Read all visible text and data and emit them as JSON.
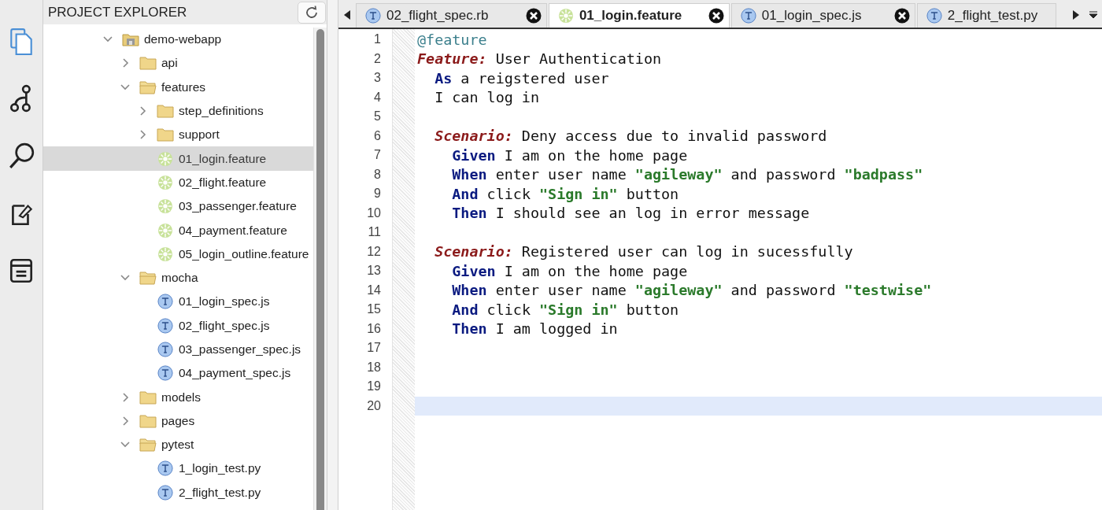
{
  "activity_bar": [
    {
      "kind": "files",
      "selected": true
    },
    {
      "kind": "branch",
      "selected": false
    },
    {
      "kind": "search",
      "selected": false
    },
    {
      "kind": "note",
      "selected": false
    },
    {
      "kind": "list",
      "selected": false
    }
  ],
  "explorer": {
    "title": "PROJECT EXPLORER",
    "tree": [
      {
        "label": "demo-webapp",
        "kind": "project",
        "expanded": true,
        "selected": false,
        "children": [
          {
            "label": "api",
            "kind": "folder",
            "expanded": false,
            "selected": false
          },
          {
            "label": "features",
            "kind": "folder",
            "expanded": true,
            "selected": false,
            "children": [
              {
                "label": "step_definitions",
                "kind": "folder",
                "expanded": false,
                "selected": false
              },
              {
                "label": "support",
                "kind": "folder",
                "expanded": false,
                "selected": false
              },
              {
                "label": "01_login.feature",
                "kind": "feature",
                "selected": true
              },
              {
                "label": "02_flight.feature",
                "kind": "feature",
                "selected": false
              },
              {
                "label": "03_passenger.feature",
                "kind": "feature",
                "selected": false
              },
              {
                "label": "04_payment.feature",
                "kind": "feature",
                "selected": false
              },
              {
                "label": "05_login_outline.feature",
                "kind": "feature",
                "selected": false
              }
            ]
          },
          {
            "label": "mocha",
            "kind": "folder",
            "expanded": true,
            "selected": false,
            "children": [
              {
                "label": "01_login_spec.js",
                "kind": "test",
                "selected": false
              },
              {
                "label": "02_flight_spec.js",
                "kind": "test",
                "selected": false
              },
              {
                "label": "03_passenger_spec.js",
                "kind": "test",
                "selected": false
              },
              {
                "label": "04_payment_spec.js",
                "kind": "test",
                "selected": false
              }
            ]
          },
          {
            "label": "models",
            "kind": "folder",
            "expanded": false,
            "selected": false
          },
          {
            "label": "pages",
            "kind": "folder",
            "expanded": false,
            "selected": false
          },
          {
            "label": "pytest",
            "kind": "folder",
            "expanded": true,
            "selected": false,
            "children": [
              {
                "label": "1_login_test.py",
                "kind": "test",
                "selected": false
              },
              {
                "label": "2_flight_test.py",
                "kind": "test",
                "selected": false
              }
            ]
          }
        ]
      }
    ]
  },
  "tabs": [
    {
      "label": "02_flight_spec.rb",
      "kind": "test",
      "selected": false,
      "closable": true
    },
    {
      "label": "01_login.feature",
      "kind": "feature",
      "selected": true,
      "closable": true
    },
    {
      "label": "01_login_spec.js",
      "kind": "test",
      "selected": false,
      "closable": true
    },
    {
      "label": "2_flight_test.py",
      "kind": "test",
      "selected": false,
      "closable": false
    }
  ],
  "editor": {
    "lines": [
      {
        "number": "1",
        "current": false,
        "tokens": [
          {
            "kind": "tag",
            "text": "@feature"
          }
        ]
      },
      {
        "number": "2",
        "current": false,
        "tokens": [
          {
            "kind": "keyword",
            "text": "Feature:"
          },
          {
            "kind": "plain",
            "text": " User Authentication"
          }
        ]
      },
      {
        "number": "3",
        "current": false,
        "tokens": [
          {
            "kind": "step",
            "text": "  As"
          },
          {
            "kind": "plain",
            "text": " a reigstered user"
          }
        ]
      },
      {
        "number": "4",
        "current": false,
        "tokens": [
          {
            "kind": "plain",
            "text": "  I can log in"
          }
        ]
      },
      {
        "number": "5",
        "current": false
      },
      {
        "number": "6",
        "current": false,
        "tokens": [
          {
            "kind": "keyword",
            "text": "  Scenario:"
          },
          {
            "kind": "plain",
            "text": " Deny access due to invalid password"
          }
        ]
      },
      {
        "number": "7",
        "current": false,
        "tokens": [
          {
            "kind": "step",
            "text": "    Given"
          },
          {
            "kind": "plain",
            "text": " I am on the home page"
          }
        ]
      },
      {
        "number": "8",
        "current": false,
        "tokens": [
          {
            "kind": "step",
            "text": "    When"
          },
          {
            "kind": "plain",
            "text": " enter user name "
          },
          {
            "kind": "string",
            "text": "\"agileway\""
          },
          {
            "kind": "plain",
            "text": " and password "
          },
          {
            "kind": "string",
            "text": "\"badpass\""
          }
        ]
      },
      {
        "number": "9",
        "current": false,
        "tokens": [
          {
            "kind": "step",
            "text": "    And"
          },
          {
            "kind": "plain",
            "text": " click "
          },
          {
            "kind": "string",
            "text": "\"Sign in\""
          },
          {
            "kind": "plain",
            "text": " button"
          }
        ]
      },
      {
        "number": "10",
        "current": false,
        "tokens": [
          {
            "kind": "step",
            "text": "    Then"
          },
          {
            "kind": "plain",
            "text": " I should see an log in error message"
          }
        ]
      },
      {
        "number": "11",
        "current": false
      },
      {
        "number": "12",
        "current": false,
        "tokens": [
          {
            "kind": "keyword",
            "text": "  Scenario:"
          },
          {
            "kind": "plain",
            "text": " Registered user can log in sucessfully"
          }
        ]
      },
      {
        "number": "13",
        "current": false,
        "tokens": [
          {
            "kind": "step",
            "text": "    Given"
          },
          {
            "kind": "plain",
            "text": " I am on the home page"
          }
        ]
      },
      {
        "number": "14",
        "current": false,
        "tokens": [
          {
            "kind": "step",
            "text": "    When"
          },
          {
            "kind": "plain",
            "text": " enter user name "
          },
          {
            "kind": "string",
            "text": "\"agileway\""
          },
          {
            "kind": "plain",
            "text": " and password "
          },
          {
            "kind": "string",
            "text": "\"testwise\""
          }
        ]
      },
      {
        "number": "15",
        "current": false,
        "tokens": [
          {
            "kind": "step",
            "text": "    And"
          },
          {
            "kind": "plain",
            "text": " click "
          },
          {
            "kind": "string",
            "text": "\"Sign in\""
          },
          {
            "kind": "plain",
            "text": " button"
          }
        ]
      },
      {
        "number": "16",
        "current": false,
        "tokens": [
          {
            "kind": "step",
            "text": "    Then"
          },
          {
            "kind": "plain",
            "text": " I am logged in"
          }
        ]
      },
      {
        "number": "17",
        "current": false
      },
      {
        "number": "18",
        "current": false
      },
      {
        "number": "19",
        "current": false
      },
      {
        "number": "20",
        "current": true
      }
    ]
  }
}
